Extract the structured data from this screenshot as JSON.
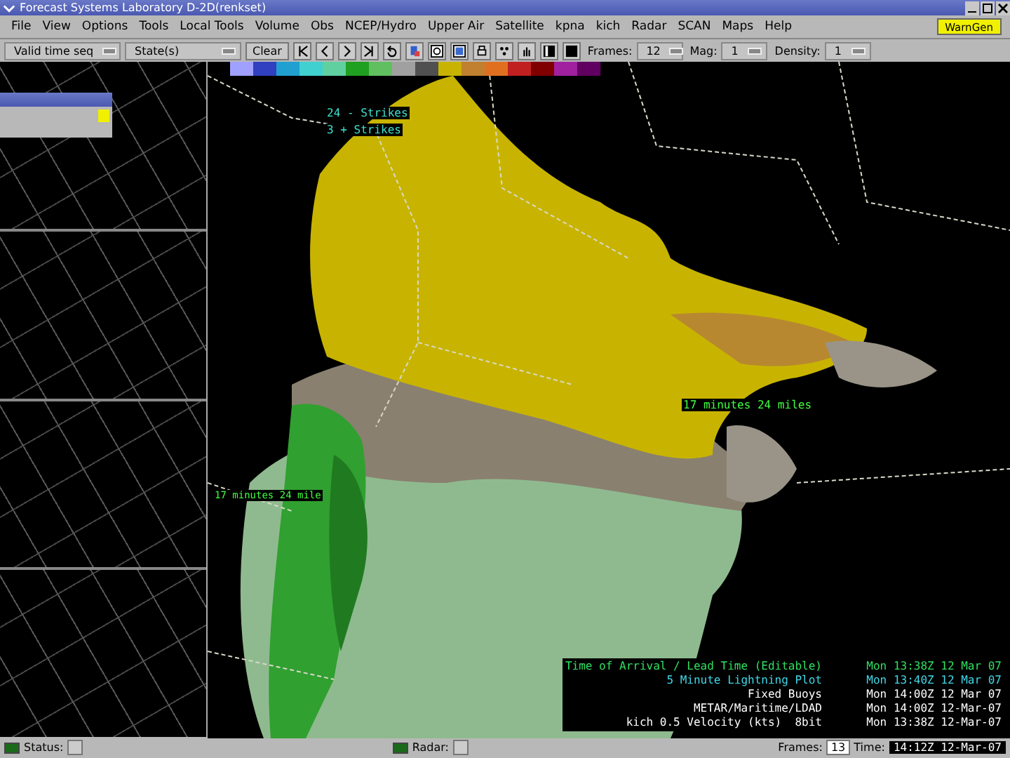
{
  "window": {
    "title": "Forecast Systems Laboratory D-2D(renkset)"
  },
  "menu": [
    "File",
    "View",
    "Options",
    "Tools",
    "Local Tools",
    "Volume",
    "Obs",
    "NCEP/Hydro",
    "Upper Air",
    "Satellite",
    "kpna",
    "kich",
    "Radar",
    "SCAN",
    "Maps",
    "Help"
  ],
  "warngen_button": "WarnGen",
  "toolbar": {
    "time_mode": "Valid time seq",
    "state": "State(s)",
    "clear": "Clear",
    "frames_label": "Frames:",
    "frames": "12",
    "mag_label": "Mag:",
    "mag": "1",
    "density_label": "Density:",
    "density": "1"
  },
  "map": {
    "labels": [
      {
        "text": "24 - Strikes"
      },
      {
        "text": "3 + Strikes"
      },
      {
        "text": "17 minutes 24 miles"
      },
      {
        "text": "17 minutes 24 mile"
      }
    ]
  },
  "legend": [
    {
      "name": "Time of Arrival / Lead Time (Editable)",
      "time": "Mon 13:38Z 12 Mar 07",
      "color": "#30e060"
    },
    {
      "name": "5 Minute Lightning Plot",
      "time": "Mon 13:40Z 12 Mar 07",
      "color": "#40d8e8"
    },
    {
      "name": "Fixed Buoys",
      "time": "Mon 14:00Z 12 Mar 07",
      "color": "#ffffff"
    },
    {
      "name": "METAR/Maritime/LDAD",
      "time": "Mon 14:00Z 12-Mar-07",
      "color": "#ffffff"
    },
    {
      "name": "kich 0.5 Velocity (kts)  8bit",
      "time": "Mon 13:38Z 12-Mar-07",
      "color": "#ffffff"
    }
  ],
  "status_bar": {
    "status_label": "Status:",
    "radar_label": "Radar:",
    "frames_label": "Frames:",
    "frames": "13",
    "time_label": "Time:",
    "time": "14:12Z 12-Mar-07"
  }
}
